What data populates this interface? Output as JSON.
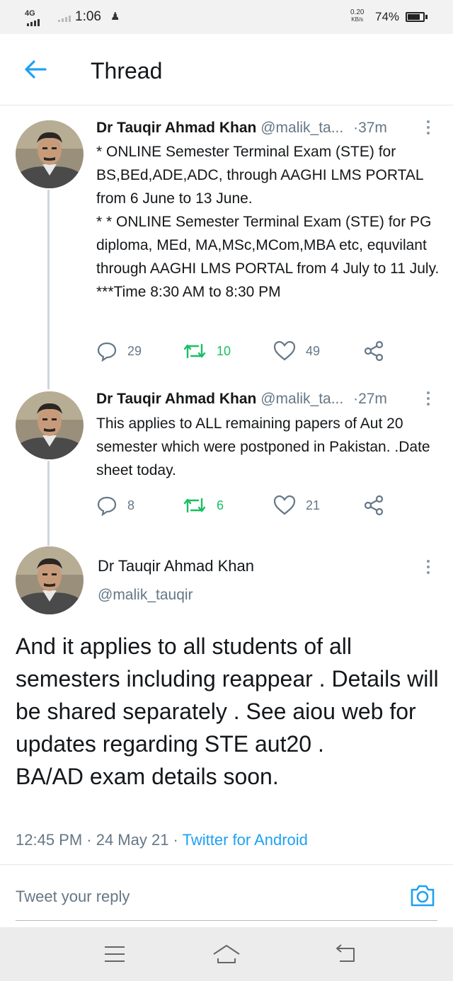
{
  "status_bar": {
    "network": "4G",
    "time": "1:06",
    "speed_value": "0.20",
    "speed_unit": "KB/s",
    "battery": "74%"
  },
  "header": {
    "title": "Thread",
    "back_icon": "arrow-left-icon"
  },
  "thread": [
    {
      "name": "Dr Tauqir Ahmad Khan",
      "handle": "@malik_ta...",
      "time": "·37m",
      "text": "* ONLINE Semester Terminal Exam (STE) for BS,BEd,ADE,ADC, through AAGHI LMS PORTAL from 6 June to 13 June.\n* * ONLINE Semester Terminal Exam (STE) for PG diploma, MEd, MA,MSc,MCom,MBA etc, equvilant through AAGHI LMS PORTAL from 4 July  to 11 July.\n***Time 8:30 AM to 8:30 PM",
      "replies": "29",
      "retweets": "10",
      "likes": "49"
    },
    {
      "name": "Dr Tauqir Ahmad Khan",
      "handle": "@malik_ta...",
      "time": "·27m",
      "text": "This applies to ALL remaining papers of Aut 20 semester which were postponed in Pakistan. .Date sheet today.",
      "replies": "8",
      "retweets": "6",
      "likes": "21"
    }
  ],
  "main_tweet": {
    "name": "Dr Tauqir Ahmad Khan",
    "handle": "@malik_tauqir",
    "text": "And it applies to all students of all semesters including reappear . Details will be shared  separately . See aiou web for updates regarding STE aut20 .\nBA/AD exam details soon.",
    "timestamp": "12:45 PM · 24 May 21 · ",
    "source": "Twitter for Android"
  },
  "reply_bar": {
    "placeholder": "Tweet your reply",
    "camera_icon": "camera-icon"
  },
  "colors": {
    "accent": "#1da1f2",
    "retweet": "#17bf63",
    "text": "#14171a",
    "secondary": "#657786"
  }
}
